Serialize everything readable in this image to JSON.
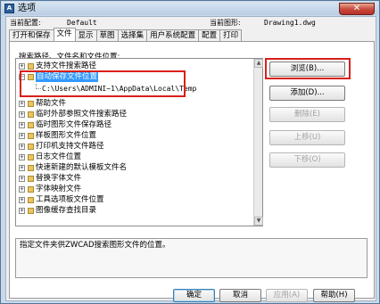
{
  "window": {
    "title": "选项",
    "app_icon": "A",
    "close_symbol": "✕"
  },
  "info": {
    "current_profile_label": "当前配置:",
    "current_profile_value": "Default",
    "current_drawing_label": "当前图形:",
    "current_drawing_value": "Drawing1.dwg"
  },
  "tabs": [
    {
      "label": "打开和保存"
    },
    {
      "label": "文件"
    },
    {
      "label": "显示"
    },
    {
      "label": "草图"
    },
    {
      "label": "选择集"
    },
    {
      "label": "用户系统配置"
    },
    {
      "label": "配置"
    },
    {
      "label": "打印"
    }
  ],
  "active_tab": "文件",
  "group_label": "搜索路径、文件名和文件位置:",
  "tree": {
    "items": [
      {
        "label": "支持文件搜索路径",
        "expander": "+"
      },
      {
        "label": "自动保存文件位置",
        "expander": "−",
        "selected": true
      },
      {
        "label": "C:\\Users\\ADMINI~1\\AppData\\Local\\Temp",
        "child": true
      },
      {
        "label": "帮助文件",
        "expander": "+"
      },
      {
        "label": "临时外部参照文件搜索路径",
        "expander": "+"
      },
      {
        "label": "临时图形文件保存路径",
        "expander": "+"
      },
      {
        "label": "样板图形文件位置",
        "expander": "+"
      },
      {
        "label": "打印机支持文件路径",
        "expander": "+"
      },
      {
        "label": "日志文件位置",
        "expander": "+"
      },
      {
        "label": "快速新建的默认模板文件名",
        "expander": "+"
      },
      {
        "label": "替换字体文件",
        "expander": "+"
      },
      {
        "label": "字体映射文件",
        "expander": "+"
      },
      {
        "label": "工具选项板文件位置",
        "expander": "+"
      },
      {
        "label": "图像缓存查找目录",
        "expander": "+"
      }
    ]
  },
  "side_buttons": {
    "browse": "浏览(B)...",
    "add": "添加(D)...",
    "delete": "删除(E)",
    "move_up": "上移(U)",
    "move_down": "下移(O)"
  },
  "description": "指定文件夹供ZWCAD搜索图形文件的位置。",
  "footer": {
    "ok": "确定",
    "cancel": "取消",
    "apply": "应用(A)",
    "help": "帮助(H)"
  },
  "scrollbar": {
    "up_arrow": "▲",
    "down_arrow": "▼"
  },
  "colors": {
    "selection": "#3399ff",
    "highlight_annotation": "#d8201a"
  }
}
